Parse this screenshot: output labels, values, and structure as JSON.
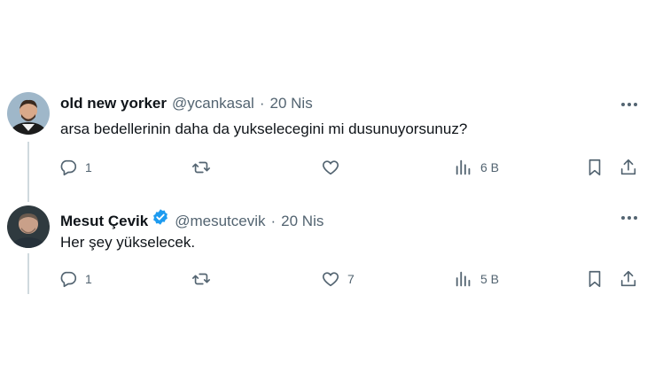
{
  "tweets": [
    {
      "author": {
        "name": "old new yorker",
        "handle": "@ycankasal",
        "verified": false
      },
      "separator": "·",
      "date": "20 Nis",
      "text": "arsa bedellerinin daha da yukselecegini mi dusunuyorsunuz?",
      "stats": {
        "replies": "1",
        "reposts": "",
        "likes": "",
        "views": "6 B"
      }
    },
    {
      "author": {
        "name": "Mesut Çevik",
        "handle": "@mesutcevik",
        "verified": true
      },
      "separator": "·",
      "date": "20 Nis",
      "text": "Her şey yükselecek.",
      "stats": {
        "replies": "1",
        "reposts": "",
        "likes": "7",
        "views": "5 B"
      }
    }
  ],
  "icons": [
    "avatar",
    "verified-badge-icon",
    "more-icon",
    "reply-icon",
    "repost-icon",
    "like-icon",
    "views-icon",
    "bookmark-icon",
    "share-icon"
  ],
  "colors": {
    "text": "#0f1419",
    "secondary": "#536471",
    "verified": "#1d9bf0",
    "thread_line": "#cfd9de"
  }
}
